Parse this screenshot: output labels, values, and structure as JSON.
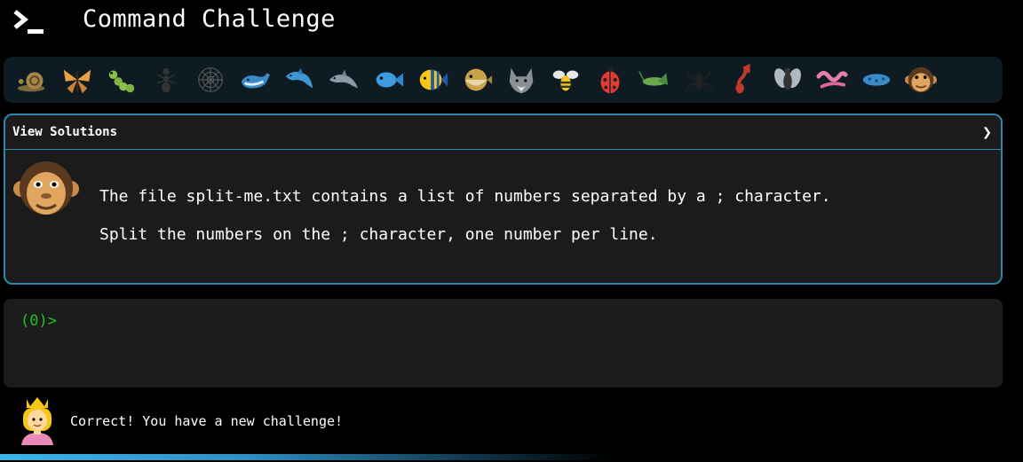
{
  "header": {
    "title": "Command Challenge",
    "logo_icon": "terminal-prompt-icon"
  },
  "levels": [
    {
      "name": "snail"
    },
    {
      "name": "butterfly"
    },
    {
      "name": "caterpillar"
    },
    {
      "name": "ant"
    },
    {
      "name": "spider-web"
    },
    {
      "name": "whale"
    },
    {
      "name": "dolphin"
    },
    {
      "name": "dolphin-grey"
    },
    {
      "name": "fish"
    },
    {
      "name": "tropical-fish"
    },
    {
      "name": "blowfish"
    },
    {
      "name": "wolf"
    },
    {
      "name": "bee"
    },
    {
      "name": "ladybug"
    },
    {
      "name": "cricket"
    },
    {
      "name": "spider"
    },
    {
      "name": "scorpion"
    },
    {
      "name": "fly"
    },
    {
      "name": "worm"
    },
    {
      "name": "microbe"
    },
    {
      "name": "monkey"
    }
  ],
  "challenge": {
    "solutions_label": "View Solutions",
    "chevron": "❯",
    "description_line1": "The file split-me.txt contains a list of numbers separated by a ; character.",
    "description_line2": "Split the numbers on the ; character, one number per line.",
    "avatar_icon": "monkey-icon"
  },
  "terminal": {
    "prompt": "(0)>"
  },
  "message": {
    "text": "Correct! You have a new challenge!",
    "avatar_icon": "princess-icon"
  },
  "progress": {
    "fraction": 0.6
  },
  "colors": {
    "accent": "#2e86a8",
    "prompt": "#21c421",
    "panel": "#1b1b1b",
    "bar": "#0e1b22"
  }
}
